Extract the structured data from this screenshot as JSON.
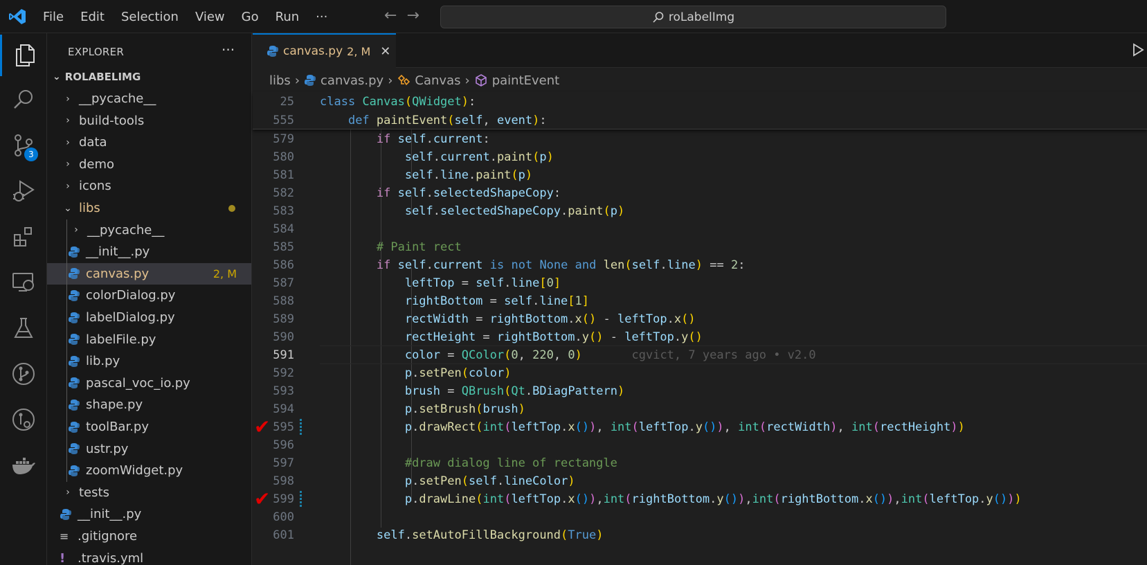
{
  "menu": [
    "File",
    "Edit",
    "Selection",
    "View",
    "Go",
    "Run",
    "···"
  ],
  "search": {
    "text": "roLabelImg"
  },
  "activity": {
    "scm_badge": "3"
  },
  "explorer": {
    "header": "EXPLORER",
    "root": "ROLABELIMG",
    "items": [
      {
        "label": "__pycache__",
        "kind": "folder",
        "depth": 0,
        "open": false
      },
      {
        "label": "build-tools",
        "kind": "folder",
        "depth": 0,
        "open": false
      },
      {
        "label": "data",
        "kind": "folder",
        "depth": 0,
        "open": false
      },
      {
        "label": "demo",
        "kind": "folder",
        "depth": 0,
        "open": false
      },
      {
        "label": "icons",
        "kind": "folder",
        "depth": 0,
        "open": false
      },
      {
        "label": "libs",
        "kind": "folder",
        "depth": 0,
        "open": true,
        "modified": true
      },
      {
        "label": "__pycache__",
        "kind": "folder",
        "depth": 1,
        "open": false
      },
      {
        "label": "__init__.py",
        "kind": "py",
        "depth": 1
      },
      {
        "label": "canvas.py",
        "kind": "py",
        "depth": 1,
        "selected": true,
        "status": "2, M"
      },
      {
        "label": "colorDialog.py",
        "kind": "py",
        "depth": 1
      },
      {
        "label": "labelDialog.py",
        "kind": "py",
        "depth": 1
      },
      {
        "label": "labelFile.py",
        "kind": "py",
        "depth": 1
      },
      {
        "label": "lib.py",
        "kind": "py",
        "depth": 1
      },
      {
        "label": "pascal_voc_io.py",
        "kind": "py",
        "depth": 1
      },
      {
        "label": "shape.py",
        "kind": "py",
        "depth": 1
      },
      {
        "label": "toolBar.py",
        "kind": "py",
        "depth": 1
      },
      {
        "label": "ustr.py",
        "kind": "py",
        "depth": 1
      },
      {
        "label": "zoomWidget.py",
        "kind": "py",
        "depth": 1
      },
      {
        "label": "tests",
        "kind": "folder",
        "depth": 0,
        "open": false
      },
      {
        "label": "__init__.py",
        "kind": "py",
        "depth": 0
      },
      {
        "label": ".gitignore",
        "kind": "txt",
        "depth": 0
      },
      {
        "label": ".travis.yml",
        "kind": "yml",
        "depth": 0
      }
    ]
  },
  "tab": {
    "name": "canvas.py",
    "status": "2, M"
  },
  "breadcrumb": {
    "folder": "libs",
    "file": "canvas.py",
    "class": "Canvas",
    "method": "paintEvent"
  },
  "sticky_lines": [
    "25",
    "555"
  ],
  "line_numbers": [
    "579",
    "580",
    "581",
    "582",
    "583",
    "584",
    "585",
    "586",
    "587",
    "588",
    "589",
    "590",
    "591",
    "592",
    "593",
    "594",
    "595",
    "596",
    "597",
    "598",
    "599",
    "600",
    "601"
  ],
  "blame": "cgvict, 7 years ago • v2.0",
  "colors": {
    "accent": "#0078d4",
    "modified": "#e2c08d",
    "check": "#e00000"
  }
}
